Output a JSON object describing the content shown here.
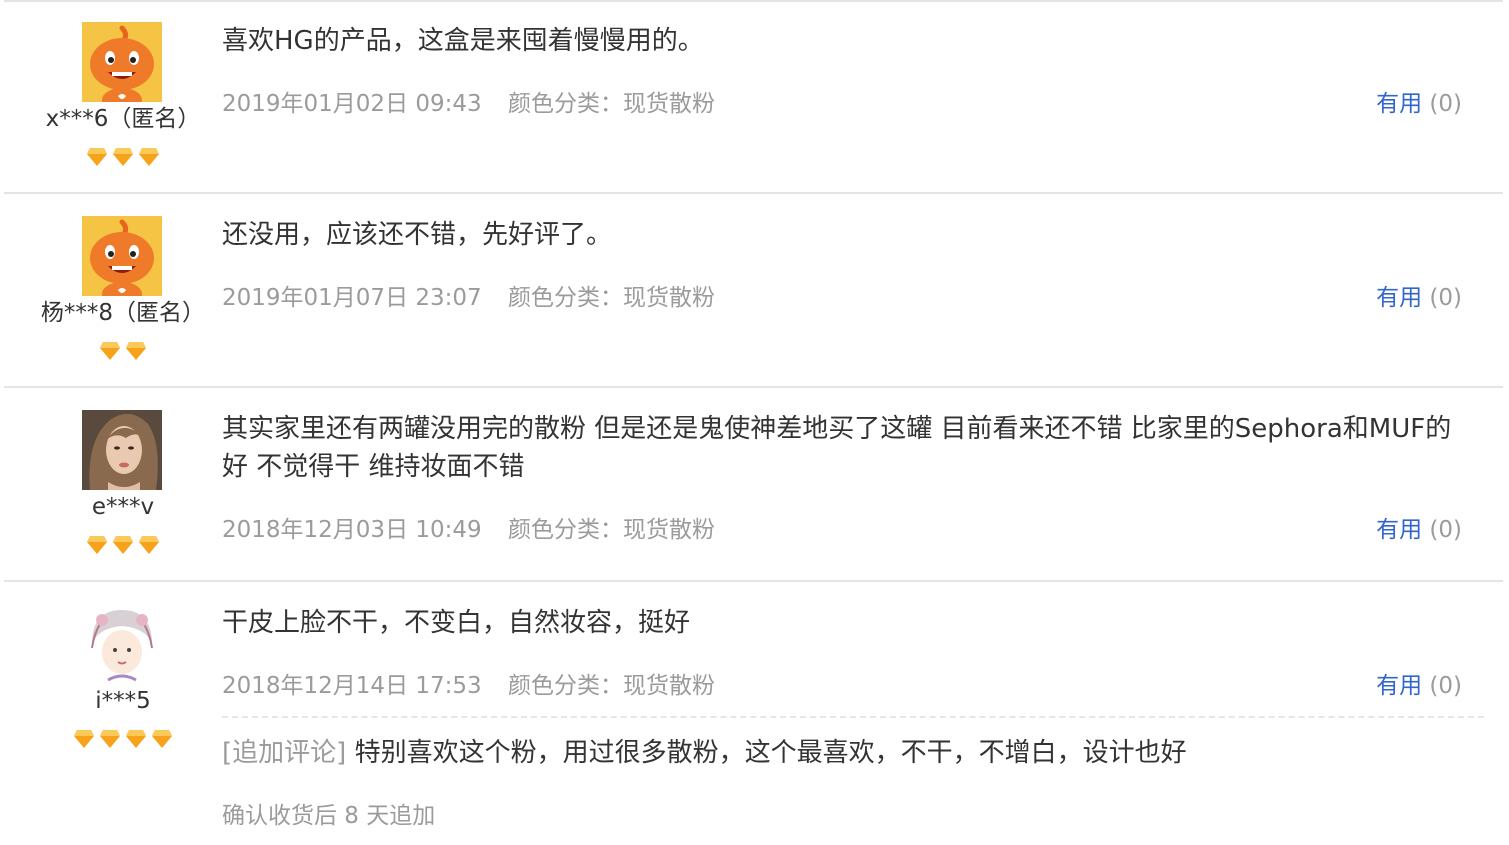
{
  "reviews": [
    {
      "user": "x***6（匿名）",
      "avatar": "orange-mascot",
      "gems": 3,
      "text": "喜欢HG的产品，这盒是来囤着慢慢用的。",
      "date": "2019年01月02日 09:43",
      "sku": "颜色分类：现货散粉",
      "useful_label": "有用",
      "useful_count": "(0)"
    },
    {
      "user": "杨***8（匿名）",
      "avatar": "orange-mascot",
      "gems": 2,
      "text": "还没用，应该还不错，先好评了。",
      "date": "2019年01月07日 23:07",
      "sku": "颜色分类：现货散粉",
      "useful_label": "有用",
      "useful_count": "(0)"
    },
    {
      "user": "e***v",
      "avatar": "woman-photo",
      "gems": 3,
      "text": "其实家里还有两罐没用完的散粉 但是还是鬼使神差地买了这罐 目前看来还不错 比家里的Sephora和MUF的好 不觉得干 维持妆面不错",
      "date": "2018年12月03日 10:49",
      "sku": "颜色分类：现货散粉",
      "useful_label": "有用",
      "useful_count": "(0)"
    },
    {
      "user": "i***5",
      "avatar": "cartoon-girl",
      "gems": 4,
      "text": "干皮上脸不干，不变白，自然妆容，挺好",
      "date": "2018年12月14日 17:53",
      "sku": "颜色分类：现货散粉",
      "useful_label": "有用",
      "useful_count": "(0)",
      "append_tag": "[追加评论]",
      "append_text": "特别喜欢这个粉，用过很多散粉，这个最喜欢，不干，不增白，设计也好",
      "append_note": "确认收货后 8 天追加"
    }
  ],
  "colors": {
    "link": "#3366cc",
    "muted": "#9b9b9b",
    "text": "#333333",
    "gem": "#f7a21b",
    "divider": "#e4e4e4"
  }
}
